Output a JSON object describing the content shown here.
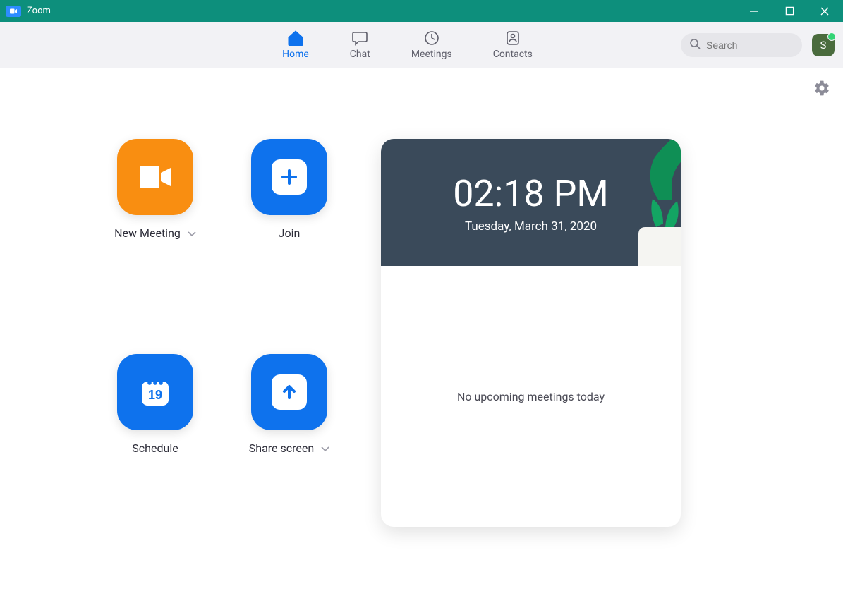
{
  "window": {
    "title": "Zoom"
  },
  "nav": {
    "home": "Home",
    "chat": "Chat",
    "meetings": "Meetings",
    "contacts": "Contacts"
  },
  "search": {
    "placeholder": "Search",
    "value": ""
  },
  "avatar": {
    "initial": "S"
  },
  "actions": {
    "new_meeting": "New Meeting",
    "join": "Join",
    "schedule": "Schedule",
    "schedule_day": "19",
    "share_screen": "Share screen"
  },
  "calendar": {
    "time": "02:18 PM",
    "date": "Tuesday, March 31, 2020",
    "empty": "No upcoming meetings today"
  }
}
